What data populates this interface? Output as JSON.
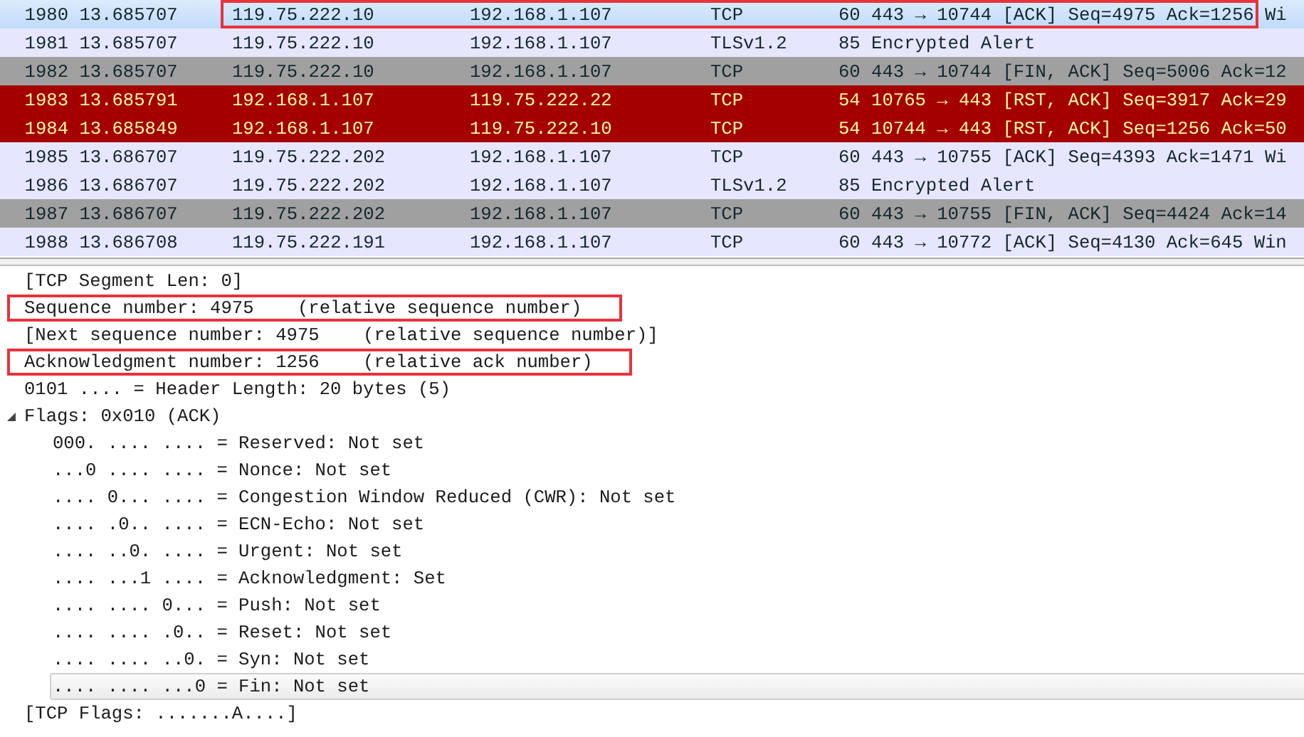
{
  "packet_list": {
    "rows": [
      {
        "no": "1980",
        "time": "13.685707",
        "source": "119.75.222.10",
        "destination": "192.168.1.107",
        "protocol": "TCP",
        "info": "60 443 → 10744 [ACK] Seq=4975 Ack=1256 Wi",
        "kind": "selected",
        "annotated": true
      },
      {
        "no": "1981",
        "time": "13.685707",
        "source": "119.75.222.10",
        "destination": "192.168.1.107",
        "protocol": "TLSv1.2",
        "info": "85 Encrypted Alert",
        "kind": "normal",
        "annotated": false
      },
      {
        "no": "1982",
        "time": "13.685707",
        "source": "119.75.222.10",
        "destination": "192.168.1.107",
        "protocol": "TCP",
        "info": "60 443 → 10744 [FIN, ACK] Seq=5006 Ack=12",
        "kind": "gray",
        "annotated": false
      },
      {
        "no": "1983",
        "time": "13.685791",
        "source": "192.168.1.107",
        "destination": "119.75.222.22",
        "protocol": "TCP",
        "info": "54 10765 → 443 [RST, ACK] Seq=3917 Ack=29",
        "kind": "red",
        "annotated": false
      },
      {
        "no": "1984",
        "time": "13.685849",
        "source": "192.168.1.107",
        "destination": "119.75.222.10",
        "protocol": "TCP",
        "info": "54 10744 → 443 [RST, ACK] Seq=1256 Ack=50",
        "kind": "red",
        "annotated": false
      },
      {
        "no": "1985",
        "time": "13.686707",
        "source": "119.75.222.202",
        "destination": "192.168.1.107",
        "protocol": "TCP",
        "info": "60 443 → 10755 [ACK] Seq=4393 Ack=1471 Wi",
        "kind": "normal",
        "annotated": false
      },
      {
        "no": "1986",
        "time": "13.686707",
        "source": "119.75.222.202",
        "destination": "192.168.1.107",
        "protocol": "TLSv1.2",
        "info": "85 Encrypted Alert",
        "kind": "normal",
        "annotated": false
      },
      {
        "no": "1987",
        "time": "13.686707",
        "source": "119.75.222.202",
        "destination": "192.168.1.107",
        "protocol": "TCP",
        "info": "60 443 → 10755 [FIN, ACK] Seq=4424 Ack=14",
        "kind": "gray",
        "annotated": false
      },
      {
        "no": "1988",
        "time": "13.686708",
        "source": "119.75.222.191",
        "destination": "192.168.1.107",
        "protocol": "TCP",
        "info": "60 443 → 10772 [ACK] Seq=4130 Ack=645 Win",
        "kind": "normal",
        "annotated": false
      }
    ]
  },
  "details": [
    {
      "text": "[TCP Segment Len: 0]",
      "annotated": false,
      "selected": false
    },
    {
      "text": "Sequence number: 4975    (relative sequence number)",
      "annotated": true,
      "selected": false
    },
    {
      "text": "[Next sequence number: 4975    (relative sequence number)]",
      "annotated": false,
      "selected": false
    },
    {
      "text": "Acknowledgment number: 1256    (relative ack number)",
      "annotated": true,
      "selected": false
    },
    {
      "text": "0101 .... = Header Length: 20 bytes (5)",
      "annotated": false,
      "selected": false
    },
    {
      "text": "Flags: 0x010 (ACK)",
      "annotated": false,
      "selected": false,
      "expanded": true,
      "children": [
        {
          "text": "000. .... .... = Reserved: Not set",
          "annotated": false,
          "selected": false
        },
        {
          "text": "...0 .... .... = Nonce: Not set",
          "annotated": false,
          "selected": false
        },
        {
          "text": ".... 0... .... = Congestion Window Reduced (CWR): Not set",
          "annotated": false,
          "selected": false
        },
        {
          "text": ".... .0.. .... = ECN-Echo: Not set",
          "annotated": false,
          "selected": false
        },
        {
          "text": ".... ..0. .... = Urgent: Not set",
          "annotated": false,
          "selected": false
        },
        {
          "text": ".... ...1 .... = Acknowledgment: Set",
          "annotated": false,
          "selected": false
        },
        {
          "text": ".... .... 0... = Push: Not set",
          "annotated": false,
          "selected": false
        },
        {
          "text": ".... .... .0.. = Reset: Not set",
          "annotated": false,
          "selected": false
        },
        {
          "text": ".... .... ..0. = Syn: Not set",
          "annotated": false,
          "selected": false
        },
        {
          "text": ".... .... ...0 = Fin: Not set",
          "annotated": false,
          "selected": true
        }
      ]
    },
    {
      "text": "[TCP Flags: .......A....]",
      "annotated": false,
      "selected": false
    }
  ]
}
